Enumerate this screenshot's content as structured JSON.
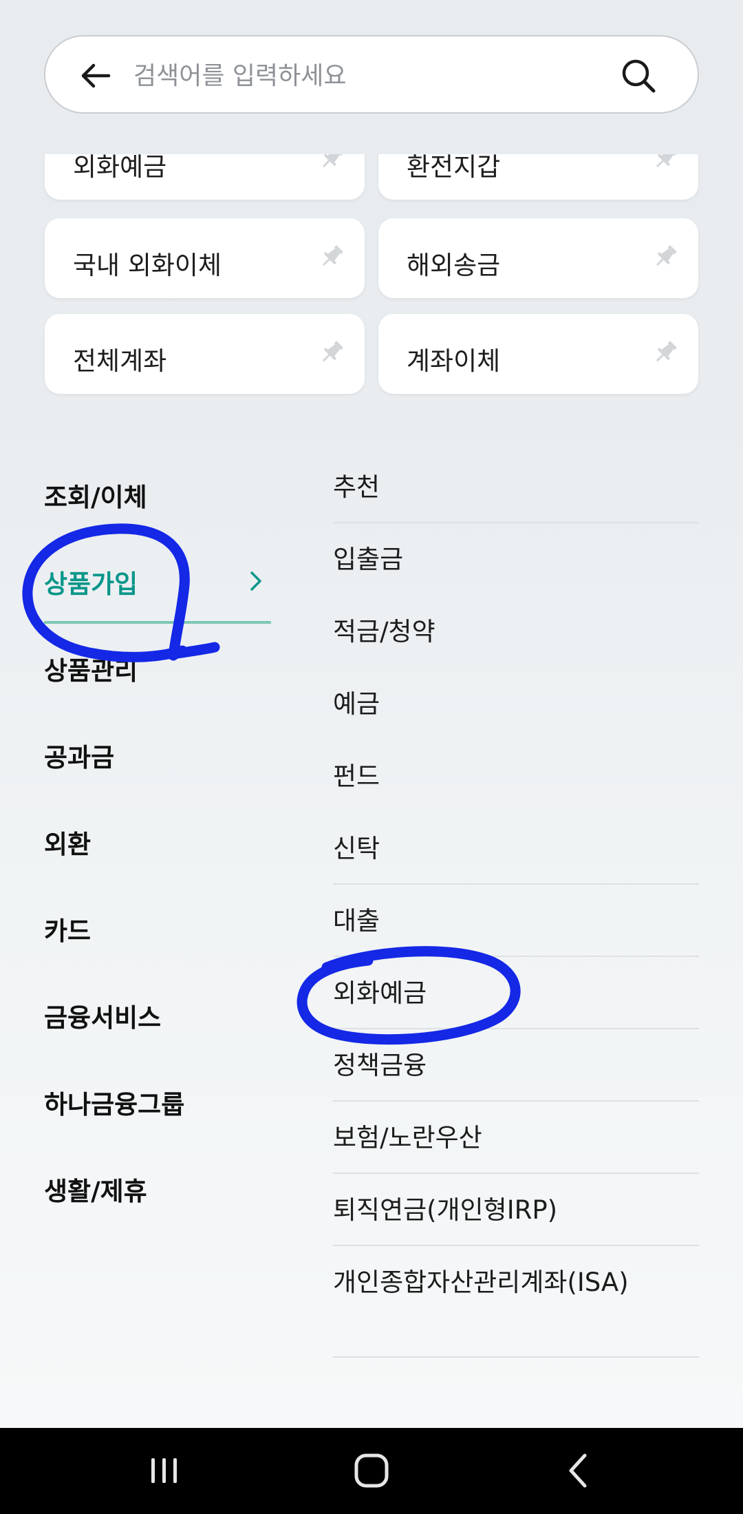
{
  "search": {
    "placeholder": "검색어를 입력하세요"
  },
  "quick_cards": [
    {
      "label": "외화예금"
    },
    {
      "label": "환전지갑"
    },
    {
      "label": "국내 외화이체"
    },
    {
      "label": "해외송금"
    },
    {
      "label": "전체계좌"
    },
    {
      "label": "계좌이체"
    }
  ],
  "categories": [
    {
      "label": "조회/이체"
    },
    {
      "label": "상품가입",
      "active": true
    },
    {
      "label": "상품관리"
    },
    {
      "label": "공과금"
    },
    {
      "label": "외환"
    },
    {
      "label": "카드"
    },
    {
      "label": "금융서비스"
    },
    {
      "label": "하나금융그룹"
    },
    {
      "label": "생활/제휴"
    }
  ],
  "subcategories": [
    {
      "label": "추천"
    },
    {
      "label": "입출금"
    },
    {
      "label": "적금/청약"
    },
    {
      "label": "예금"
    },
    {
      "label": "펀드"
    },
    {
      "label": "신탁"
    },
    {
      "label": "대출"
    },
    {
      "label": "외화예금"
    },
    {
      "label": "정책금융"
    },
    {
      "label": "보험/노란우산"
    },
    {
      "label": "퇴직연금(개인형IRP)"
    },
    {
      "label": "개인종합자산관리계좌(ISA)"
    }
  ],
  "colors": {
    "accent": "#0a968a",
    "annotation": "#1428e6",
    "navbar": "#000000"
  },
  "icons": {
    "back": "arrow-left-icon",
    "search": "magnifier-icon",
    "pin": "pin-icon",
    "chevron": "chevron-right-icon",
    "nav_recents": "recents-icon",
    "nav_home": "home-icon",
    "nav_back": "back-icon"
  }
}
